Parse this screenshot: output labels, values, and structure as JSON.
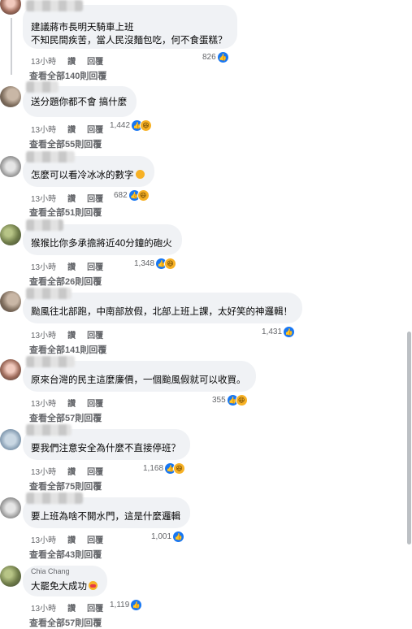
{
  "meta_labels": {
    "like": "讚",
    "reply": "回覆"
  },
  "colors": {
    "bubble": "#f0f2f5",
    "link": "#65676b",
    "like_icon": "#1877f2",
    "haha_icon": "#f7b125",
    "love_icon": "#f33e58"
  },
  "comments": [
    {
      "author": "",
      "text_lines": [
        "建議蔣市長明天騎車上班",
        "不知民間疾苦，當人民沒麵包吃，何不食蛋糕？"
      ],
      "time": "13小時",
      "reaction_count": "826",
      "reactions": [
        "like-icon"
      ],
      "replies": "查看全部140則回覆"
    },
    {
      "author": "",
      "text_lines": [
        "送分題你都不會 搞什麼"
      ],
      "time": "13小時",
      "reaction_count": "1,442",
      "reactions": [
        "like-icon",
        "haha-icon"
      ],
      "replies": "查看全部55則回覆"
    },
    {
      "author": "",
      "text_lines": [
        "怎麼可以看冷冰冰的數字"
      ],
      "time": "13小時",
      "reaction_count": "682",
      "reactions": [
        "like-icon",
        "haha-icon"
      ],
      "replies": "查看全部51則回覆"
    },
    {
      "author": "",
      "text_lines": [
        "猴猴比你多承擔將近40分鐘的砲火"
      ],
      "time": "13小時",
      "reaction_count": "1,348",
      "reactions": [
        "like-icon",
        "haha-icon"
      ],
      "replies": "查看全部26則回覆"
    },
    {
      "author": "",
      "text_lines": [
        "颱風往北部跑，中南部放假，北部上班上課，太好笑的神邏輯！"
      ],
      "time": "13小時",
      "reaction_count": "1,431",
      "reactions": [
        "like-icon"
      ],
      "replies": "查看全部141則回覆"
    },
    {
      "author": "",
      "text_lines": [
        "原來台灣的民主這麼廉價，一個颱風假就可以收買。"
      ],
      "time": "13小時",
      "reaction_count": "355",
      "reactions": [
        "like-icon",
        "haha-icon"
      ],
      "replies": "查看全部57則回覆"
    },
    {
      "author": "",
      "text_lines": [
        "要我們注意安全為什麼不直接停班？"
      ],
      "time": "13小時",
      "reaction_count": "1,168",
      "reactions": [
        "like-icon",
        "haha-icon"
      ],
      "replies": "查看全部75則回覆"
    },
    {
      "author": "",
      "text_lines": [
        "要上班為啥不開水門，這是什麼邏輯"
      ],
      "time": "13小時",
      "reaction_count": "1,001",
      "reactions": [
        "like-icon"
      ],
      "replies": "查看全部43則回覆"
    },
    {
      "author": "Chia Chang",
      "text_lines": [
        "大罷免大成功"
      ],
      "time": "13小時",
      "reaction_count": "1,119",
      "reactions": [
        "like-icon"
      ],
      "replies": "查看全部57則回覆"
    }
  ]
}
